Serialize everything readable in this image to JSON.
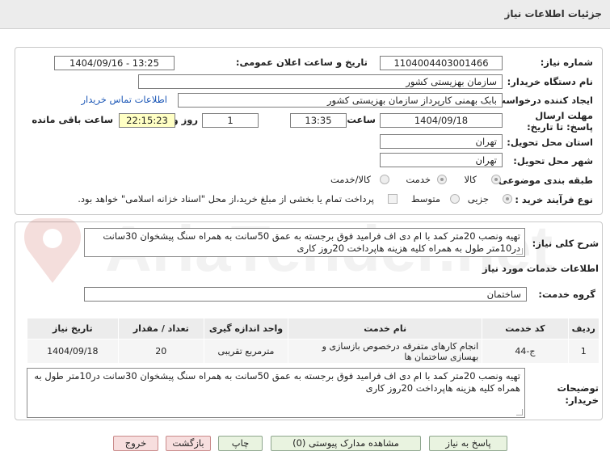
{
  "header": {
    "title": "جزئیات اطلاعات نیاز"
  },
  "form": {
    "need_number_label": "شماره نیاز:",
    "need_number": "1104004403001466",
    "announce_label": "تاریخ و ساعت اعلان عمومی:",
    "announce_value": "1404/09/16 - 13:25",
    "buyer_org_label": "نام دستگاه خریدار:",
    "buyer_org": "سازمان بهزیستی کشور",
    "creator_label": "ایجاد کننده درخواست:",
    "creator": "بابک بهمنی کارپرداز سازمان بهزیستی کشور",
    "contact_link": "اطلاعات تماس خریدار",
    "deadline_label": "مهلت ارسال پاسخ: تا تاریخ:",
    "deadline_date": "1404/09/18",
    "time_label": "ساعت",
    "deadline_time": "13:35",
    "days_value": "1",
    "days_label": "روز و",
    "remaining_time": "22:15:23",
    "remaining_label": "ساعت باقی مانده",
    "province_label": "استان محل تحویل:",
    "province": "تهران",
    "city_label": "شهر محل تحویل:",
    "city": "تهران",
    "category_label": "طبقه بندی موضوعی:",
    "category_options": [
      "کالا",
      "خدمت",
      "کالا/خدمت"
    ],
    "process_label": "نوع فرآیند خرید :",
    "process_options": [
      "جزیی",
      "متوسط"
    ],
    "payment_note": "پرداخت تمام یا بخشی از مبلغ خرید،از محل \"اسناد خزانه اسلامی\" خواهد بود."
  },
  "description": {
    "label": "شرح کلی نیاز:",
    "text": "تهیه ونصب 20متر کمد با ام دی اف فرامید فوق برجسته به عمق 50سانت به همراه سنگ پیشخوان 30سانت در10متر طول به همراه کلیه هزینه هاپرداخت 20روز کاری"
  },
  "services": {
    "section_title": "اطلاعات خدمات مورد نیاز",
    "group_label": "گروه خدمت:",
    "group_value": "ساختمان",
    "columns": [
      "ردیف",
      "کد خدمت",
      "نام خدمت",
      "واحد اندازه گیری",
      "تعداد / مقدار",
      "تاریخ نیاز"
    ],
    "rows": [
      [
        "1",
        "ج-44",
        "انجام کارهای متفرقه درخصوص بازسازی و بهسازی ساختمان ها",
        "مترمربع تقریبی",
        "20",
        "1404/09/18"
      ]
    ]
  },
  "buyer_notes": {
    "label": "توضیحات خریدار:",
    "text": "تهیه ونصب 20متر کمد با ام دی اف فرامید فوق برجسته به عمق 50سانت به همراه سنگ پیشخوان 30سانت در10متر طول به همراه کلیه هزینه هاپرداخت 20روز کاری"
  },
  "buttons": {
    "reply": "پاسخ به نیاز",
    "attachments": "مشاهده مدارک پیوستی (0)",
    "print": "چاپ",
    "back": "بازگشت",
    "exit": "خروج"
  },
  "watermark": {
    "text": "AriaTender.net"
  },
  "colors": {
    "link": "#1a56b6",
    "yellow_field": "#ffffc4",
    "button_green": "#e9f3e0",
    "button_red": "#f7dede"
  }
}
